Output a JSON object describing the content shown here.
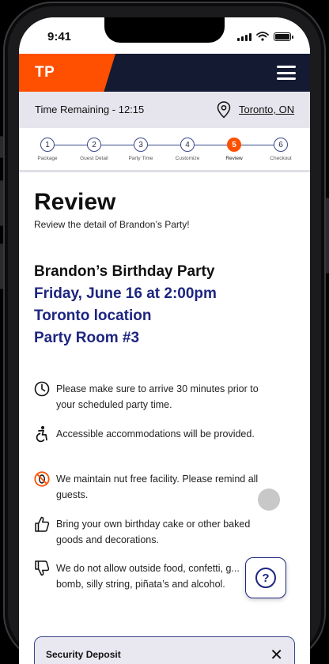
{
  "status_bar": {
    "time": "9:41"
  },
  "header": {
    "logo": "TP",
    "menu_icon": "hamburger-menu-icon"
  },
  "timer_bar": {
    "time_remaining": "Time Remaining - 12:15",
    "location_link": "Toronto, ON",
    "location_icon": "map-pin-icon"
  },
  "stepper": {
    "current": 5,
    "steps": [
      {
        "num": "1",
        "label": "Package"
      },
      {
        "num": "2",
        "label": "Guest Detail"
      },
      {
        "num": "3",
        "label": "Party Time"
      },
      {
        "num": "4",
        "label": "Customize"
      },
      {
        "num": "5",
        "label": "Review"
      },
      {
        "num": "6",
        "label": "Checkout"
      }
    ]
  },
  "review": {
    "title": "Review",
    "subtitle": "Review the detail of Brandon’s Party!",
    "party_name": "Brandon’s Birthday Party",
    "date_time": "Friday, June 16 at 2:00pm",
    "location": "Toronto location",
    "room": "Party Room #3"
  },
  "info_items": [
    {
      "icon": "clock-icon",
      "text": "Please make sure to arrive 30 minutes prior to your scheduled party time."
    },
    {
      "icon": "accessibility-icon",
      "text": "Accessible accommodations will be provided."
    },
    {
      "icon": "no-nuts-icon",
      "text": "We maintain nut free facility. Please remind all guests."
    },
    {
      "icon": "thumbs-up-icon",
      "text": "Bring your own birthday cake or other baked goods and decorations."
    },
    {
      "icon": "thumbs-down-icon",
      "text": "We do not allow outside food, confetti, g... bomb, silly string, piñata’s and alcohol."
    }
  ],
  "help": {
    "icon": "help-question-icon",
    "label": "?"
  },
  "deposit": {
    "label": "Security Deposit",
    "close": "✕"
  },
  "colors": {
    "brand_orange": "#fe5000",
    "navy": "#141a32",
    "accent_blue": "#1d2580"
  }
}
